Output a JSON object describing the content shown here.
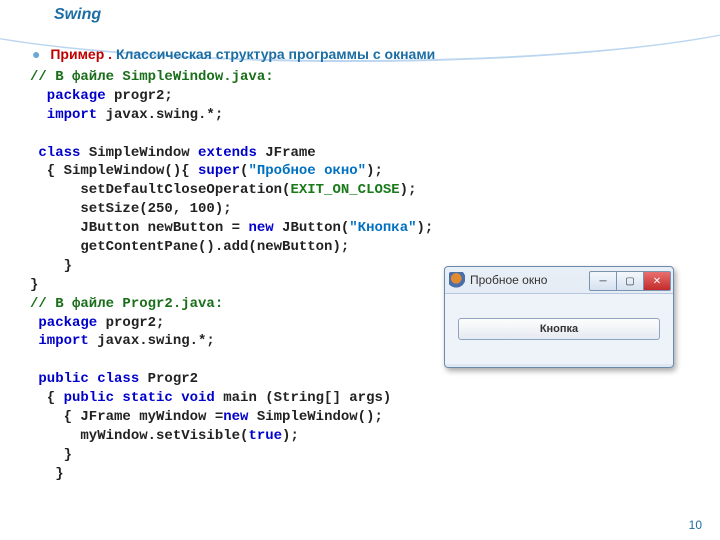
{
  "slide": {
    "title": "Swing",
    "subtitle_word1": "Пример .",
    "subtitle_word2": " Классическая структура программы с окнами",
    "page_number": "10"
  },
  "code": {
    "l1": "// В файле SimpleWindow.java:",
    "l2_a": "  package",
    "l2_b": " progr2;",
    "l3_a": "  import",
    "l3_b": " javax.swing.*;",
    "blank1": " ",
    "l4_a": " class",
    "l4_b": " SimpleWindow ",
    "l4_c": "extends",
    "l4_d": " JFrame",
    "l5_a": "  { SimpleWindow(){ ",
    "l5_b": "super",
    "l5_c": "(",
    "l5_d": "\"Пробное окно\"",
    "l5_e": ");",
    "l6_a": "      setDefaultCloseOperation(",
    "l6_b": "EXIT_ON_CLOSE",
    "l6_c": ");",
    "l7": "      setSize(250, 100);",
    "l8_a": "      JButton newButton = ",
    "l8_b": "new",
    "l8_c": " JButton(",
    "l8_d": "\"Кнопка\"",
    "l8_e": ");",
    "l9": "      getContentPane().add(newButton);",
    "l10": "    }",
    "l11": "}",
    "l12": "// В файле Progr2.java:",
    "l13_a": " package",
    "l13_b": " progr2;",
    "l14_a": " import",
    "l14_b": " javax.swing.*;",
    "blank2": " ",
    "l15_a": " public class",
    "l15_b": " Progr2",
    "l16_a": "  { ",
    "l16_b": "public static void",
    "l16_c": " main (String[] args)",
    "l17_a": "    { JFrame myWindow =",
    "l17_b": "new",
    "l17_c": " SimpleWindow();",
    "l18_a": "      myWindow.setVisible(",
    "l18_b": "true",
    "l18_c": ");",
    "l19": "    }",
    "l20": "   }"
  },
  "window": {
    "title": "Пробное окно",
    "min": "─",
    "max": "▢",
    "close": "✕",
    "button_label": "Кнопка"
  }
}
